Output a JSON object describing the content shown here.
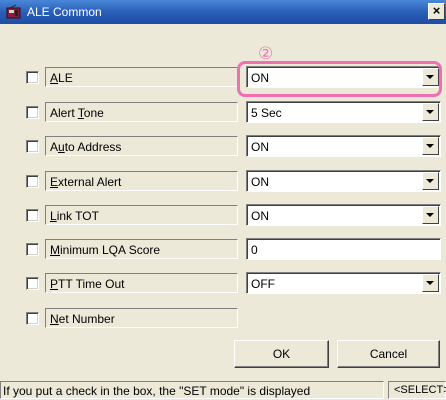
{
  "window": {
    "title": "ALE Common",
    "close_glyph": "×"
  },
  "annotation": {
    "number": "②",
    "color": "#f06fb3"
  },
  "rows": [
    {
      "name": "ALE",
      "pre": "",
      "u": "A",
      "post": "LE",
      "value": "ON",
      "dropdown": true,
      "checked": false
    },
    {
      "name": "Alert Tone",
      "pre": "Alert ",
      "u": "T",
      "post": "one",
      "value": "5 Sec",
      "dropdown": true,
      "checked": false
    },
    {
      "name": "Auto Address",
      "pre": "A",
      "u": "u",
      "post": "to Address",
      "value": "ON",
      "dropdown": true,
      "checked": false
    },
    {
      "name": "External Alert",
      "pre": "",
      "u": "E",
      "post": "xternal Alert",
      "value": "ON",
      "dropdown": true,
      "checked": false
    },
    {
      "name": "Link TOT",
      "pre": "",
      "u": "L",
      "post": "ink TOT",
      "value": "ON",
      "dropdown": true,
      "checked": false
    },
    {
      "name": "Minimum LQA Score",
      "pre": "",
      "u": "M",
      "post": "inimum LQA Score",
      "value": "0",
      "dropdown": false,
      "checked": false
    },
    {
      "name": "PTT Time Out",
      "pre": "",
      "u": "P",
      "post": "TT Time Out",
      "value": "OFF",
      "dropdown": true,
      "checked": false
    },
    {
      "name": "Net Number",
      "pre": "",
      "u": "N",
      "post": "et Number",
      "value": null,
      "dropdown": false,
      "checked": false
    }
  ],
  "buttons": {
    "ok": "OK",
    "cancel": "Cancel"
  },
  "status": {
    "message": "If you put a check in the box, the \"SET mode\" is displayed",
    "mode": "<SELECT>"
  },
  "icons": {
    "app": "radio-app-icon",
    "close": "close-icon",
    "dropdown": "chevron-down-icon"
  }
}
